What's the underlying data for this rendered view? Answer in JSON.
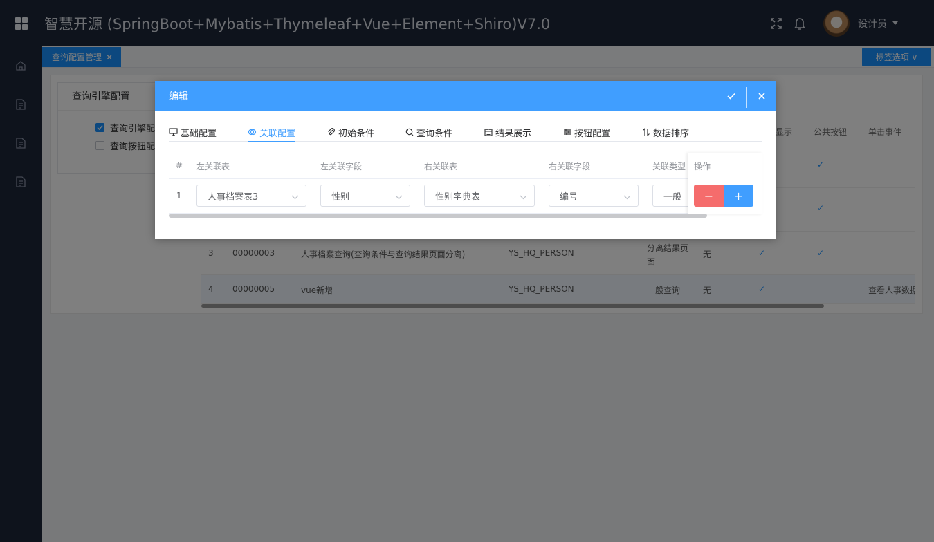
{
  "header": {
    "app_title": "智慧开源 (SpringBoot+Mybatis+Thymeleaf+Vue+Element+Shiro)V7.0",
    "user_name": "设计员"
  },
  "tabs": {
    "active_label": "查询配置管理",
    "close_symbol": "✕",
    "tag_options_label": "标签选项 ∨"
  },
  "left_panel": {
    "title": "查询引擎配置",
    "items": [
      {
        "label": "查询引擎配",
        "checked": true
      },
      {
        "label": "查询按钮配",
        "checked": false
      }
    ]
  },
  "bg_table": {
    "headers": [
      "显示",
      "公共按钮",
      "单击事件"
    ],
    "rows": [
      {
        "no": "3",
        "code": "00000003",
        "name": "人事档案查询(查询条件与查询结果页面分离)",
        "table": "YS_HQ_PERSON",
        "type": "分离结果页面",
        "v": "无"
      },
      {
        "no": "4",
        "code": "00000005",
        "name": "vue新增",
        "table": "YS_HQ_PERSON",
        "type": "一般查询",
        "v": "无",
        "event": "查看人事数据"
      }
    ]
  },
  "dialog": {
    "title": "编辑",
    "tabs": [
      "基础配置",
      "关联配置",
      "初始条件",
      "查询条件",
      "结果展示",
      "按钮配置",
      "数据排序"
    ],
    "active_tab": 1,
    "columns": [
      "#",
      "左关联表",
      "左关联字段",
      "右关联表",
      "右关联字段",
      "关联类型",
      "操作"
    ],
    "row": {
      "index": "1",
      "left_table": "人事档案表3",
      "left_field": "性别",
      "right_table": "性别字典表",
      "right_field": "编号",
      "join_type": "一般"
    },
    "minus_label": "−",
    "plus_label": "+"
  },
  "colors": {
    "header_bg": "#1c2638",
    "primary": "#409eff",
    "danger": "#f56c6c"
  }
}
